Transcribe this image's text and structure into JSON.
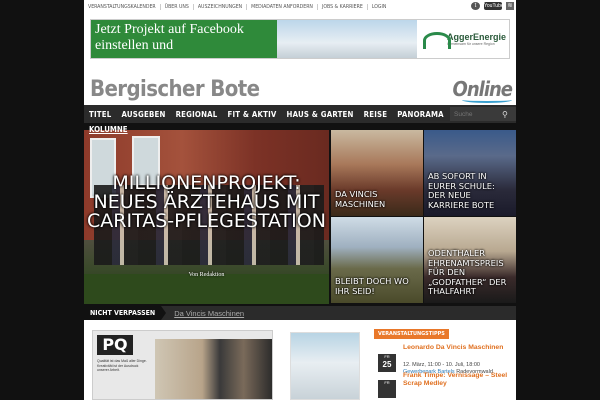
{
  "topbar": {
    "links": [
      "Veranstaltungskalender",
      "Über uns",
      "Auszeichnungen",
      "Mediadaten anfordern",
      "Jobs & Karriere",
      "Login"
    ],
    "social": {
      "twitter": "t",
      "youtube": "YouTube",
      "rss": "≋"
    }
  },
  "banner": {
    "text": "Jetzt Projekt auf Facebook einstellen und",
    "brand": "AggerEnergie",
    "brand_sub": "Gemeinsam für unsere Region"
  },
  "header": {
    "brand": "Bergischer Bote",
    "online": "Online"
  },
  "nav": {
    "items": [
      "Titel",
      "Ausgeben",
      "Regional",
      "Fit & Aktiv",
      "Haus & Garten",
      "Reise",
      "Panorama"
    ],
    "overflow": "KOLUMNE",
    "search_placeholder": "Suche"
  },
  "hero": {
    "title": "Millionenprojekt: Neues Ärztehaus mit Caritas-Pflegestation",
    "byline": "Von Redaktion"
  },
  "tiles": [
    {
      "caption": "Da Vincis Maschinen"
    },
    {
      "caption": "Ab sofort in eurer Schule: Der neue Karriere Bote"
    },
    {
      "caption": "Bleibt doch wo ihr seid!"
    },
    {
      "caption": "Odenthaler Ehrenamtspreis für den „Godfather“ der Thalfahrt"
    }
  ],
  "nicht_verpassen": {
    "label": "Nicht verpassen",
    "text": "Da Vincis Maschinen"
  },
  "ad": {
    "logo": "PQ",
    "text": "Qualität ist das Maß aller Dinge. Kreativität ist der Ausdruck unserer Arbeit."
  },
  "veranstaltungen": {
    "heading": "Veranstaltungstipps",
    "items": [
      {
        "day": "FR",
        "date": "25",
        "title": "Leonardo Da Vincis Maschinen",
        "time": "12. März, 11:00 - 10. Juli, 18:00",
        "place": "Gewerbepark Bartels",
        "city": "Radevormwald"
      },
      {
        "day": "FR",
        "date": "",
        "title": "Frank Timpe: Vernissage – Steel Scrap Medley",
        "time": "",
        "place": "",
        "city": ""
      }
    ]
  },
  "colors": {
    "accent": "#e9782a",
    "nav_bg": "#2b2b2b",
    "page_bg": "#111111"
  }
}
